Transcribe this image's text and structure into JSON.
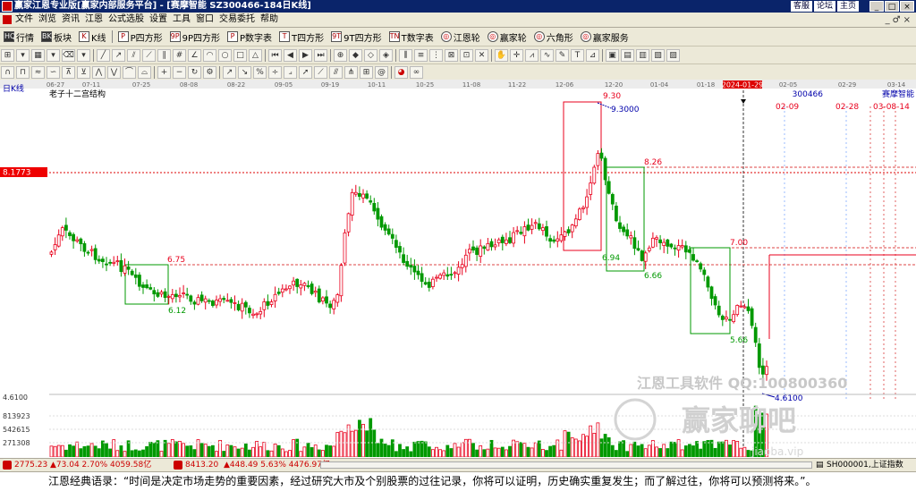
{
  "window": {
    "title": "赢家江恩专业版[赢家内部服务平台] - [赛摩智能  SZ300466-184日K线]",
    "links": [
      "客服",
      "论坛",
      "主页"
    ],
    "controls": [
      "_",
      "□",
      "×"
    ]
  },
  "menu": {
    "items": [
      "文件",
      "浏览",
      "资讯",
      "江恩",
      "公式选股",
      "设置",
      "工具",
      "窗口",
      "交易委托",
      "帮助"
    ],
    "window_controls": [
      "_",
      "♂",
      "×"
    ]
  },
  "toolbar1": {
    "items": [
      {
        "icon": "HQ",
        "label": "行情"
      },
      {
        "icon": "BK",
        "label": "板块"
      },
      {
        "icon": "K",
        "label": "K线"
      },
      {
        "icon": "P",
        "label": "P四方形"
      },
      {
        "icon": "9P",
        "label": "9P四方形"
      },
      {
        "icon": "P",
        "label": "P数字表"
      },
      {
        "icon": "T",
        "label": "T四方形"
      },
      {
        "icon": "9T",
        "label": "9T四方形"
      },
      {
        "icon": "TN",
        "label": "T数字表"
      },
      {
        "icon": "◎",
        "label": "江恩轮"
      },
      {
        "icon": "◎",
        "label": "赢家轮"
      },
      {
        "icon": "◎",
        "label": "六角形"
      },
      {
        "icon": "◎",
        "label": "赢家服务"
      }
    ]
  },
  "chart": {
    "period_label": "日K线",
    "structure_label": "老子十二宫结构",
    "stock_code": "300466",
    "stock_name": "赛摩智能",
    "top_dates": [
      "06-27",
      "07-11",
      "07-25",
      "08-08",
      "08-22",
      "09-05",
      "09-19",
      "10-11",
      "10-25",
      "11-08",
      "11-22",
      "12-06",
      "12-20",
      "01-04",
      "01-18",
      "2024-01-29",
      "02-05",
      "02-29",
      "03-14"
    ],
    "highlight_date": "2024-01-29",
    "marker_dates": [
      "02-09",
      "02-28",
      "03-08-14"
    ],
    "level_marker": "8.1773",
    "price_labels": {
      "p930": "9.30",
      "p93000": "9.3000",
      "p826": "8.26",
      "p700": "7.00",
      "p694": "6.94",
      "p675": "6.75",
      "p666": "6.66",
      "p612": "6.12",
      "p566": "5.66",
      "p46100": "4.6100",
      "p46100_axis": "4.6100"
    },
    "volume_labels": [
      "813923",
      "542615",
      "271308"
    ],
    "watermark_line1": "江恩工具软件  QQ:100800360",
    "watermark_line2": "赢家聊吧",
    "watermark_sub": "jiaoba.vip"
  },
  "status": {
    "sh_index": "2775.23",
    "sh_change": "▲73.04 2.70% 4059.58亿",
    "sz_index": "8413.20",
    "sz_change": "▲448.49 5.63% 4476.97亿",
    "right_code": "SH000001,上证指数"
  },
  "quote": "江恩经典语录：“时间是决定市场走势的重要因素，经过研究大市及个别股票的过往记录，你将可以证明，历史确实重复发生；而了解过往，你将可以预测将来。”。",
  "colors": {
    "title_bar": "#0a246a",
    "up_candle": "#e8001c",
    "down_candle": "#009900",
    "box_red": "#e8001c",
    "box_green": "#009900",
    "label_blue": "#0000aa",
    "level_red": "#e8001c"
  }
}
